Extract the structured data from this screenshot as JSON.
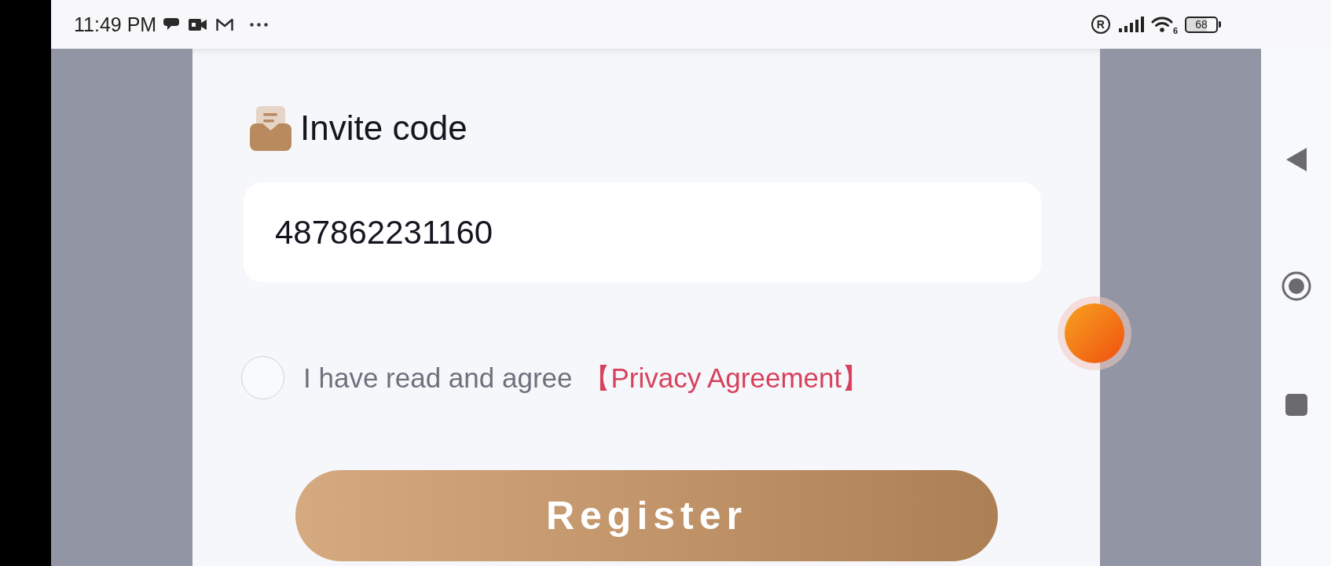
{
  "status_bar": {
    "time": "11:49 PM",
    "indicator": "R",
    "wifi_label": "6",
    "battery": "68"
  },
  "form": {
    "invite": {
      "label": "Invite code",
      "value": "487862231160"
    },
    "agreement": {
      "checked": false,
      "text": "I have read and agree",
      "link": "【Privacy Agreement】"
    },
    "submit": "Register"
  }
}
